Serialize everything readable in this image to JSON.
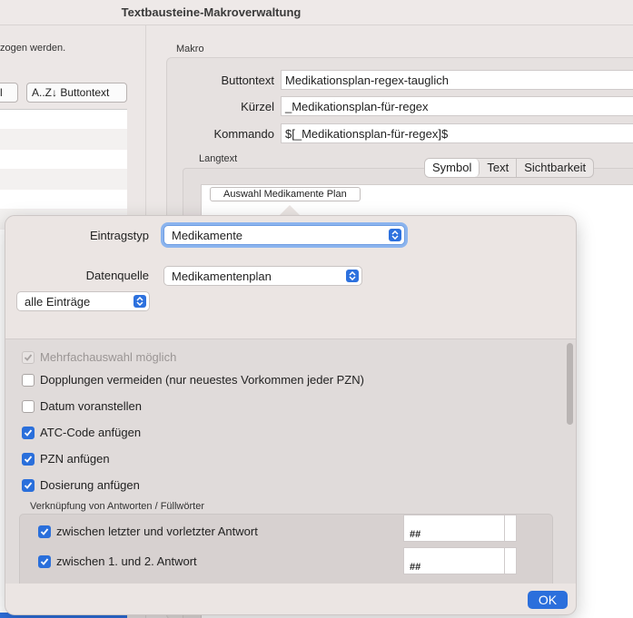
{
  "window": {
    "title": "Textbausteine-Makroverwaltung"
  },
  "left": {
    "hint": "zogen werden.",
    "btn_partial": "l",
    "sort_button": "A..Z↓ Buttontext"
  },
  "macro": {
    "section": "Makro",
    "buttontext_label": "Buttontext",
    "buttontext_value": "Medikationsplan-regex-tauglich",
    "kuerzel_label": "Kürzel",
    "kuerzel_value": "_Medikationsplan-für-regex",
    "kommando_label": "Kommando",
    "kommando_value": "$[_Medikationsplan-für-regex]$",
    "langtext_label": "Langtext",
    "tabs": [
      "Symbol",
      "Text",
      "Sichtbarkeit"
    ],
    "active_tab": "Symbol",
    "chip": "Auswahl Medikamente Plan"
  },
  "popover": {
    "eintragstyp_label": "Eintragstyp",
    "eintragstyp_value": "Medikamente",
    "datenquelle_label": "Datenquelle",
    "datenquelle_value": "Medikamentenplan",
    "filter_value": "alle Einträge",
    "options": [
      {
        "label": "Mehrfachauswahl möglich",
        "checked": true,
        "disabled": true
      },
      {
        "label": "Dopplungen vermeiden (nur neuestes Vorkommen jeder PZN)",
        "checked": false,
        "disabled": false
      },
      {
        "label": "Datum voranstellen",
        "checked": false,
        "disabled": false
      },
      {
        "label": "ATC-Code anfügen",
        "checked": true,
        "disabled": false
      },
      {
        "label": "PZN anfügen",
        "checked": true,
        "disabled": false
      },
      {
        "label": "Dosierung anfügen",
        "checked": true,
        "disabled": false
      }
    ],
    "link_section": "Verknüpfung von Antworten / Füllwörter",
    "link_rows": [
      {
        "label": "zwischen letzter und vorletzter  Antwort",
        "checked": true,
        "value": "##"
      },
      {
        "label": "zwischen 1. und 2. Antwort",
        "checked": true,
        "value": "##"
      }
    ],
    "ok_label": "OK"
  },
  "colors": {
    "accent": "#2b6fdc",
    "focus_ring": "#8bb4ee"
  }
}
